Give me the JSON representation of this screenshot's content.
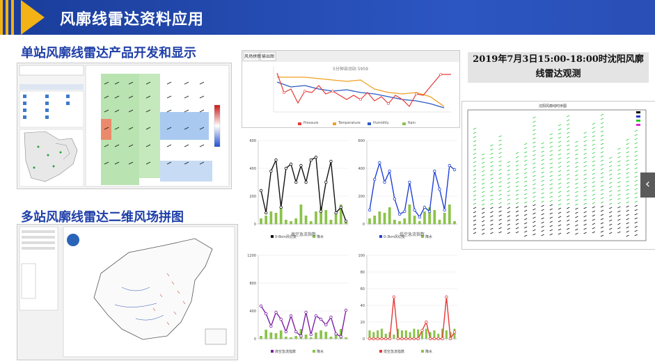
{
  "header": {
    "title": "风廓线雷达资料应用"
  },
  "sections": {
    "single": "单站风廓线雷达产品开发和显示",
    "multi": "多站风廓线雷达二维风场拼图"
  },
  "caption": {
    "line1": "2019年7月3日15:00-18:00时沈阳风廓",
    "line2": "线雷达观测"
  },
  "nav": {
    "prev_glyph": "‹"
  },
  "colors": {
    "header": "#2346b0",
    "accent": "#f3b316",
    "title_text": "#1f3fa8",
    "precip": "#8bc34a",
    "line_black": "#111111",
    "line_blue": "#1f3fd6",
    "line_purple": "#7b1fa2",
    "line_red": "#e53935"
  },
  "panels": {
    "high_title": "高空急流指数",
    "low_title": "低空急流指数",
    "legend_shear1": "0-6km风切变",
    "legend_shear2": "0-3km风切变",
    "legend_high": "高空急流指数",
    "legend_low": "低空急流指数",
    "legend_rain": "降水",
    "topchart_title": "5分钟自动站 5959",
    "topchart_legend": [
      "Pressure",
      "Temperature",
      "Humidity",
      "Rain"
    ],
    "tabs": [
      "风场拼图",
      "输出图"
    ],
    "windplot_title": "沈阳风廓线时序图"
  },
  "chart_data": [
    {
      "type": "line",
      "name": "0-6km风切变",
      "ylim": [
        0,
        600
      ],
      "yticks": [
        0,
        200,
        400,
        600
      ],
      "values": [
        240,
        80,
        380,
        460,
        120,
        400,
        430,
        300,
        420,
        300,
        460,
        480,
        90,
        300,
        450,
        80,
        120,
        20
      ],
      "rain": [
        40,
        60,
        90,
        80,
        120,
        30,
        20,
        40,
        140,
        60,
        20,
        90,
        120,
        100,
        30,
        80,
        140,
        20
      ]
    },
    {
      "type": "line",
      "name": "0-3km风切变",
      "ylim": [
        0,
        600
      ],
      "yticks": [
        0,
        200,
        400,
        600
      ],
      "values": [
        100,
        320,
        440,
        300,
        380,
        180,
        70,
        90,
        300,
        100,
        50,
        120,
        90,
        380,
        250,
        100,
        420,
        390
      ],
      "rain": [
        40,
        60,
        90,
        80,
        120,
        30,
        20,
        40,
        140,
        60,
        20,
        90,
        120,
        100,
        30,
        80,
        140,
        20
      ]
    },
    {
      "type": "line",
      "name": "高空急流指数",
      "ylim": [
        0,
        1200
      ],
      "yticks": [
        0,
        400,
        800,
        1200
      ],
      "values": [
        470,
        360,
        180,
        380,
        280,
        100,
        330,
        100,
        40,
        380,
        60,
        330,
        280,
        200,
        310,
        70,
        30,
        410
      ],
      "rain": [
        40,
        130,
        90,
        80,
        120,
        30,
        20,
        40,
        140,
        60,
        20,
        90,
        120,
        100,
        30,
        80,
        140,
        20
      ]
    },
    {
      "type": "line",
      "name": "低空急流指数",
      "ylim": [
        0,
        100
      ],
      "yticks": [
        0,
        20,
        40,
        60,
        80,
        100
      ],
      "values": [
        0,
        0,
        0,
        0,
        0,
        0,
        50,
        0,
        0,
        0,
        0,
        0,
        0,
        10,
        20,
        0,
        0,
        0,
        0,
        50,
        0,
        8
      ],
      "rain": [
        10,
        8,
        10,
        12,
        6,
        8,
        5,
        12,
        10,
        10,
        8,
        12,
        11,
        10,
        12,
        8,
        10,
        6,
        12,
        10,
        8,
        12
      ]
    }
  ]
}
